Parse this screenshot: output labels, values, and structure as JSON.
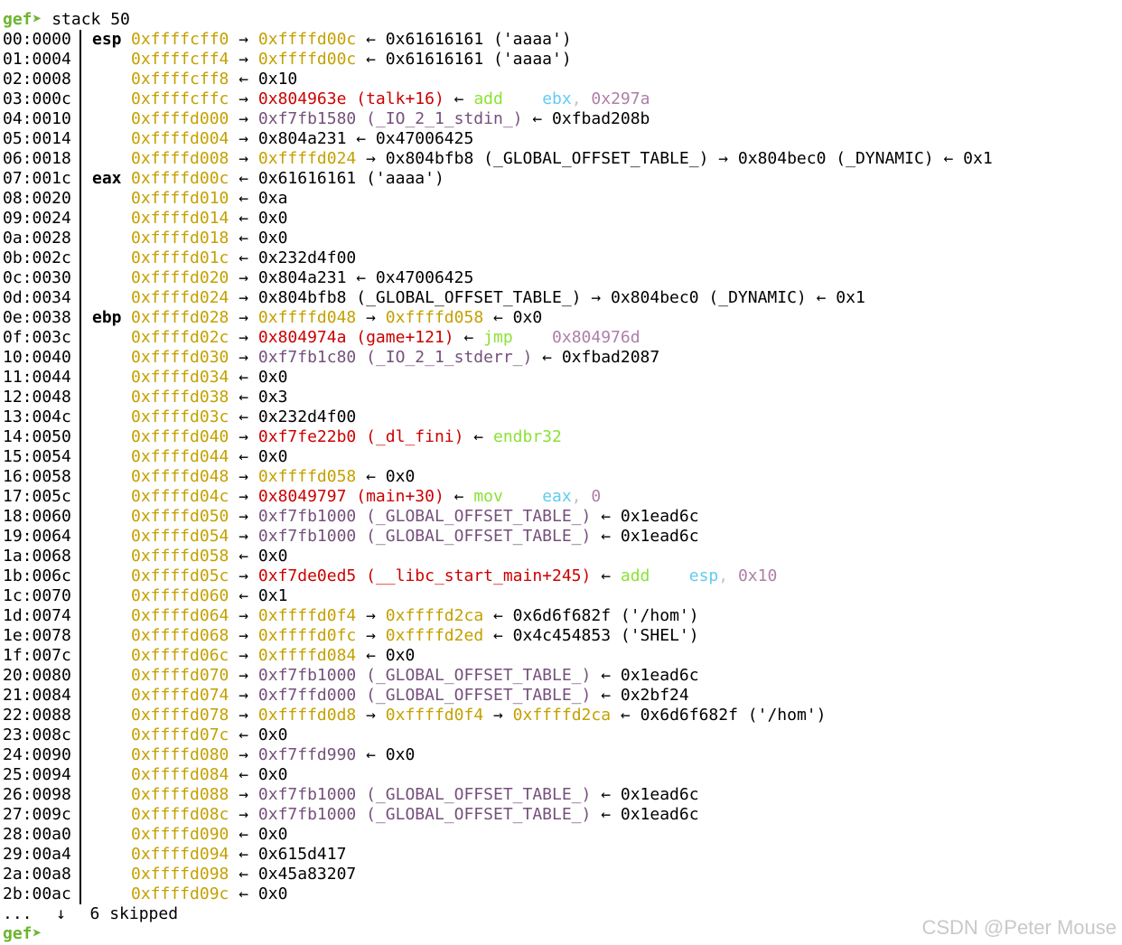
{
  "prompt": "gef➤",
  "command": "stack 50",
  "rows": [
    {
      "off": "00:0000",
      "reg": "esp",
      "spans": [
        {
          "t": "0xffffcff0",
          "c": "stack"
        },
        {
          "t": " → ",
          "c": "plain"
        },
        {
          "t": "0xffffd00c",
          "c": "stack"
        },
        {
          "t": " ← ",
          "c": "plain"
        },
        {
          "t": "0x61616161 ('aaaa')",
          "c": "plain"
        }
      ]
    },
    {
      "off": "01:0004",
      "reg": "",
      "spans": [
        {
          "t": "0xffffcff4",
          "c": "stack"
        },
        {
          "t": " → ",
          "c": "plain"
        },
        {
          "t": "0xffffd00c",
          "c": "stack"
        },
        {
          "t": " ← ",
          "c": "plain"
        },
        {
          "t": "0x61616161 ('aaaa')",
          "c": "plain"
        }
      ]
    },
    {
      "off": "02:0008",
      "reg": "",
      "spans": [
        {
          "t": "0xffffcff8",
          "c": "stack"
        },
        {
          "t": " ← ",
          "c": "plain"
        },
        {
          "t": "0x10",
          "c": "plain"
        }
      ]
    },
    {
      "off": "03:000c",
      "reg": "",
      "spans": [
        {
          "t": "0xffffcffc",
          "c": "stack"
        },
        {
          "t": " → ",
          "c": "plain"
        },
        {
          "t": "0x804963e (talk+16)",
          "c": "code"
        },
        {
          "t": " ← ",
          "c": "plain"
        },
        {
          "t": "add",
          "c": "instr"
        },
        {
          "t": "    ",
          "c": "plain"
        },
        {
          "t": "ebx",
          "c": "reg"
        },
        {
          "t": ", ",
          "c": "punct"
        },
        {
          "t": "0x297a",
          "c": "imm"
        }
      ]
    },
    {
      "off": "04:0010",
      "reg": "",
      "spans": [
        {
          "t": "0xffffd000",
          "c": "stack"
        },
        {
          "t": " → ",
          "c": "plain"
        },
        {
          "t": "0xf7fb1580 (_IO_2_1_stdin_)",
          "c": "data"
        },
        {
          "t": " ← ",
          "c": "plain"
        },
        {
          "t": "0xfbad208b",
          "c": "plain"
        }
      ]
    },
    {
      "off": "05:0014",
      "reg": "",
      "spans": [
        {
          "t": "0xffffd004",
          "c": "stack"
        },
        {
          "t": " → ",
          "c": "plain"
        },
        {
          "t": "0x804a231 ← 0x47006425",
          "c": "plain"
        }
      ]
    },
    {
      "off": "06:0018",
      "reg": "",
      "spans": [
        {
          "t": "0xffffd008",
          "c": "stack"
        },
        {
          "t": " → ",
          "c": "plain"
        },
        {
          "t": "0xffffd024",
          "c": "stack"
        },
        {
          "t": " → ",
          "c": "plain"
        },
        {
          "t": "0x804bfb8 (_GLOBAL_OFFSET_TABLE_) → 0x804bec0 (_DYNAMIC) ← 0x1",
          "c": "plain"
        }
      ]
    },
    {
      "off": "07:001c",
      "reg": "eax",
      "spans": [
        {
          "t": "0xffffd00c",
          "c": "stack"
        },
        {
          "t": " ← ",
          "c": "plain"
        },
        {
          "t": "0x61616161 ('aaaa')",
          "c": "plain"
        }
      ]
    },
    {
      "off": "08:0020",
      "reg": "",
      "spans": [
        {
          "t": "0xffffd010",
          "c": "stack"
        },
        {
          "t": " ← ",
          "c": "plain"
        },
        {
          "t": "0xa",
          "c": "plain"
        }
      ]
    },
    {
      "off": "09:0024",
      "reg": "",
      "spans": [
        {
          "t": "0xffffd014",
          "c": "stack"
        },
        {
          "t": " ← ",
          "c": "plain"
        },
        {
          "t": "0x0",
          "c": "plain"
        }
      ]
    },
    {
      "off": "0a:0028",
      "reg": "",
      "spans": [
        {
          "t": "0xffffd018",
          "c": "stack"
        },
        {
          "t": " ← ",
          "c": "plain"
        },
        {
          "t": "0x0",
          "c": "plain"
        }
      ]
    },
    {
      "off": "0b:002c",
      "reg": "",
      "spans": [
        {
          "t": "0xffffd01c",
          "c": "stack"
        },
        {
          "t": " ← ",
          "c": "plain"
        },
        {
          "t": "0x232d4f00",
          "c": "plain"
        }
      ]
    },
    {
      "off": "0c:0030",
      "reg": "",
      "spans": [
        {
          "t": "0xffffd020",
          "c": "stack"
        },
        {
          "t": " → ",
          "c": "plain"
        },
        {
          "t": "0x804a231 ← 0x47006425",
          "c": "plain"
        }
      ]
    },
    {
      "off": "0d:0034",
      "reg": "",
      "spans": [
        {
          "t": "0xffffd024",
          "c": "stack"
        },
        {
          "t": " → ",
          "c": "plain"
        },
        {
          "t": "0x804bfb8 (_GLOBAL_OFFSET_TABLE_) → 0x804bec0 (_DYNAMIC) ← 0x1",
          "c": "plain"
        }
      ]
    },
    {
      "off": "0e:0038",
      "reg": "ebp",
      "spans": [
        {
          "t": "0xffffd028",
          "c": "stack"
        },
        {
          "t": " → ",
          "c": "plain"
        },
        {
          "t": "0xffffd048",
          "c": "stack"
        },
        {
          "t": " → ",
          "c": "plain"
        },
        {
          "t": "0xffffd058",
          "c": "stack"
        },
        {
          "t": " ← ",
          "c": "plain"
        },
        {
          "t": "0x0",
          "c": "plain"
        }
      ]
    },
    {
      "off": "0f:003c",
      "reg": "",
      "spans": [
        {
          "t": "0xffffd02c",
          "c": "stack"
        },
        {
          "t": " → ",
          "c": "plain"
        },
        {
          "t": "0x804974a (game+121)",
          "c": "code"
        },
        {
          "t": " ← ",
          "c": "plain"
        },
        {
          "t": "jmp",
          "c": "instr"
        },
        {
          "t": "    ",
          "c": "plain"
        },
        {
          "t": "0x804976d",
          "c": "imm"
        }
      ]
    },
    {
      "off": "10:0040",
      "reg": "",
      "spans": [
        {
          "t": "0xffffd030",
          "c": "stack"
        },
        {
          "t": " → ",
          "c": "plain"
        },
        {
          "t": "0xf7fb1c80 (_IO_2_1_stderr_)",
          "c": "data"
        },
        {
          "t": " ← ",
          "c": "plain"
        },
        {
          "t": "0xfbad2087",
          "c": "plain"
        }
      ]
    },
    {
      "off": "11:0044",
      "reg": "",
      "spans": [
        {
          "t": "0xffffd034",
          "c": "stack"
        },
        {
          "t": " ← ",
          "c": "plain"
        },
        {
          "t": "0x0",
          "c": "plain"
        }
      ]
    },
    {
      "off": "12:0048",
      "reg": "",
      "spans": [
        {
          "t": "0xffffd038",
          "c": "stack"
        },
        {
          "t": " ← ",
          "c": "plain"
        },
        {
          "t": "0x3",
          "c": "plain"
        }
      ]
    },
    {
      "off": "13:004c",
      "reg": "",
      "spans": [
        {
          "t": "0xffffd03c",
          "c": "stack"
        },
        {
          "t": " ← ",
          "c": "plain"
        },
        {
          "t": "0x232d4f00",
          "c": "plain"
        }
      ]
    },
    {
      "off": "14:0050",
      "reg": "",
      "spans": [
        {
          "t": "0xffffd040",
          "c": "stack"
        },
        {
          "t": " → ",
          "c": "plain"
        },
        {
          "t": "0xf7fe22b0 (_dl_fini)",
          "c": "code"
        },
        {
          "t": " ← ",
          "c": "plain"
        },
        {
          "t": "endbr32",
          "c": "instr"
        }
      ]
    },
    {
      "off": "15:0054",
      "reg": "",
      "spans": [
        {
          "t": "0xffffd044",
          "c": "stack"
        },
        {
          "t": " ← ",
          "c": "plain"
        },
        {
          "t": "0x0",
          "c": "plain"
        }
      ]
    },
    {
      "off": "16:0058",
      "reg": "",
      "spans": [
        {
          "t": "0xffffd048",
          "c": "stack"
        },
        {
          "t": " → ",
          "c": "plain"
        },
        {
          "t": "0xffffd058",
          "c": "stack"
        },
        {
          "t": " ← ",
          "c": "plain"
        },
        {
          "t": "0x0",
          "c": "plain"
        }
      ]
    },
    {
      "off": "17:005c",
      "reg": "",
      "spans": [
        {
          "t": "0xffffd04c",
          "c": "stack"
        },
        {
          "t": " → ",
          "c": "plain"
        },
        {
          "t": "0x8049797 (main+30)",
          "c": "code"
        },
        {
          "t": " ← ",
          "c": "plain"
        },
        {
          "t": "mov",
          "c": "instr"
        },
        {
          "t": "    ",
          "c": "plain"
        },
        {
          "t": "eax",
          "c": "reg"
        },
        {
          "t": ", ",
          "c": "punct"
        },
        {
          "t": "0",
          "c": "imm"
        }
      ]
    },
    {
      "off": "18:0060",
      "reg": "",
      "spans": [
        {
          "t": "0xffffd050",
          "c": "stack"
        },
        {
          "t": " → ",
          "c": "plain"
        },
        {
          "t": "0xf7fb1000 (_GLOBAL_OFFSET_TABLE_)",
          "c": "data"
        },
        {
          "t": " ← ",
          "c": "plain"
        },
        {
          "t": "0x1ead6c",
          "c": "plain"
        }
      ]
    },
    {
      "off": "19:0064",
      "reg": "",
      "spans": [
        {
          "t": "0xffffd054",
          "c": "stack"
        },
        {
          "t": " → ",
          "c": "plain"
        },
        {
          "t": "0xf7fb1000 (_GLOBAL_OFFSET_TABLE_)",
          "c": "data"
        },
        {
          "t": " ← ",
          "c": "plain"
        },
        {
          "t": "0x1ead6c",
          "c": "plain"
        }
      ]
    },
    {
      "off": "1a:0068",
      "reg": "",
      "spans": [
        {
          "t": "0xffffd058",
          "c": "stack"
        },
        {
          "t": " ← ",
          "c": "plain"
        },
        {
          "t": "0x0",
          "c": "plain"
        }
      ]
    },
    {
      "off": "1b:006c",
      "reg": "",
      "spans": [
        {
          "t": "0xffffd05c",
          "c": "stack"
        },
        {
          "t": " → ",
          "c": "plain"
        },
        {
          "t": "0xf7de0ed5 (__libc_start_main+245)",
          "c": "code"
        },
        {
          "t": " ← ",
          "c": "plain"
        },
        {
          "t": "add",
          "c": "instr"
        },
        {
          "t": "    ",
          "c": "plain"
        },
        {
          "t": "esp",
          "c": "reg"
        },
        {
          "t": ", ",
          "c": "punct"
        },
        {
          "t": "0x10",
          "c": "imm"
        }
      ]
    },
    {
      "off": "1c:0070",
      "reg": "",
      "spans": [
        {
          "t": "0xffffd060",
          "c": "stack"
        },
        {
          "t": " ← ",
          "c": "plain"
        },
        {
          "t": "0x1",
          "c": "plain"
        }
      ]
    },
    {
      "off": "1d:0074",
      "reg": "",
      "spans": [
        {
          "t": "0xffffd064",
          "c": "stack"
        },
        {
          "t": " → ",
          "c": "plain"
        },
        {
          "t": "0xffffd0f4",
          "c": "stack"
        },
        {
          "t": " → ",
          "c": "plain"
        },
        {
          "t": "0xffffd2ca",
          "c": "stack"
        },
        {
          "t": " ← ",
          "c": "plain"
        },
        {
          "t": "0x6d6f682f ('/hom')",
          "c": "plain"
        }
      ]
    },
    {
      "off": "1e:0078",
      "reg": "",
      "spans": [
        {
          "t": "0xffffd068",
          "c": "stack"
        },
        {
          "t": " → ",
          "c": "plain"
        },
        {
          "t": "0xffffd0fc",
          "c": "stack"
        },
        {
          "t": " → ",
          "c": "plain"
        },
        {
          "t": "0xffffd2ed",
          "c": "stack"
        },
        {
          "t": " ← ",
          "c": "plain"
        },
        {
          "t": "0x4c454853 ('SHEL')",
          "c": "plain"
        }
      ]
    },
    {
      "off": "1f:007c",
      "reg": "",
      "spans": [
        {
          "t": "0xffffd06c",
          "c": "stack"
        },
        {
          "t": " → ",
          "c": "plain"
        },
        {
          "t": "0xffffd084",
          "c": "stack"
        },
        {
          "t": " ← ",
          "c": "plain"
        },
        {
          "t": "0x0",
          "c": "plain"
        }
      ]
    },
    {
      "off": "20:0080",
      "reg": "",
      "spans": [
        {
          "t": "0xffffd070",
          "c": "stack"
        },
        {
          "t": " → ",
          "c": "plain"
        },
        {
          "t": "0xf7fb1000 (_GLOBAL_OFFSET_TABLE_)",
          "c": "data"
        },
        {
          "t": " ← ",
          "c": "plain"
        },
        {
          "t": "0x1ead6c",
          "c": "plain"
        }
      ]
    },
    {
      "off": "21:0084",
      "reg": "",
      "spans": [
        {
          "t": "0xffffd074",
          "c": "stack"
        },
        {
          "t": " → ",
          "c": "plain"
        },
        {
          "t": "0xf7ffd000 (_GLOBAL_OFFSET_TABLE_)",
          "c": "data"
        },
        {
          "t": " ← ",
          "c": "plain"
        },
        {
          "t": "0x2bf24",
          "c": "plain"
        }
      ]
    },
    {
      "off": "22:0088",
      "reg": "",
      "spans": [
        {
          "t": "0xffffd078",
          "c": "stack"
        },
        {
          "t": " → ",
          "c": "plain"
        },
        {
          "t": "0xffffd0d8",
          "c": "stack"
        },
        {
          "t": " → ",
          "c": "plain"
        },
        {
          "t": "0xffffd0f4",
          "c": "stack"
        },
        {
          "t": " → ",
          "c": "plain"
        },
        {
          "t": "0xffffd2ca",
          "c": "stack"
        },
        {
          "t": " ← ",
          "c": "plain"
        },
        {
          "t": "0x6d6f682f ('/hom')",
          "c": "plain"
        }
      ]
    },
    {
      "off": "23:008c",
      "reg": "",
      "spans": [
        {
          "t": "0xffffd07c",
          "c": "stack"
        },
        {
          "t": " ← ",
          "c": "plain"
        },
        {
          "t": "0x0",
          "c": "plain"
        }
      ]
    },
    {
      "off": "24:0090",
      "reg": "",
      "spans": [
        {
          "t": "0xffffd080",
          "c": "stack"
        },
        {
          "t": " → ",
          "c": "plain"
        },
        {
          "t": "0xf7ffd990",
          "c": "data"
        },
        {
          "t": " ← ",
          "c": "plain"
        },
        {
          "t": "0x0",
          "c": "plain"
        }
      ]
    },
    {
      "off": "25:0094",
      "reg": "",
      "spans": [
        {
          "t": "0xffffd084",
          "c": "stack"
        },
        {
          "t": " ← ",
          "c": "plain"
        },
        {
          "t": "0x0",
          "c": "plain"
        }
      ]
    },
    {
      "off": "26:0098",
      "reg": "",
      "spans": [
        {
          "t": "0xffffd088",
          "c": "stack"
        },
        {
          "t": " → ",
          "c": "plain"
        },
        {
          "t": "0xf7fb1000 (_GLOBAL_OFFSET_TABLE_)",
          "c": "data"
        },
        {
          "t": " ← ",
          "c": "plain"
        },
        {
          "t": "0x1ead6c",
          "c": "plain"
        }
      ]
    },
    {
      "off": "27:009c",
      "reg": "",
      "spans": [
        {
          "t": "0xffffd08c",
          "c": "stack"
        },
        {
          "t": " → ",
          "c": "plain"
        },
        {
          "t": "0xf7fb1000 (_GLOBAL_OFFSET_TABLE_)",
          "c": "data"
        },
        {
          "t": " ← ",
          "c": "plain"
        },
        {
          "t": "0x1ead6c",
          "c": "plain"
        }
      ]
    },
    {
      "off": "28:00a0",
      "reg": "",
      "spans": [
        {
          "t": "0xffffd090",
          "c": "stack"
        },
        {
          "t": " ← ",
          "c": "plain"
        },
        {
          "t": "0x0",
          "c": "plain"
        }
      ]
    },
    {
      "off": "29:00a4",
      "reg": "",
      "spans": [
        {
          "t": "0xffffd094",
          "c": "stack"
        },
        {
          "t": " ← ",
          "c": "plain"
        },
        {
          "t": "0x615d417",
          "c": "plain"
        }
      ]
    },
    {
      "off": "2a:00a8",
      "reg": "",
      "spans": [
        {
          "t": "0xffffd098",
          "c": "stack"
        },
        {
          "t": " ← ",
          "c": "plain"
        },
        {
          "t": "0x45a83207",
          "c": "plain"
        }
      ]
    },
    {
      "off": "2b:00ac",
      "reg": "",
      "spans": [
        {
          "t": "0xffffd09c",
          "c": "stack"
        },
        {
          "t": " ← ",
          "c": "plain"
        },
        {
          "t": "0x0",
          "c": "plain"
        }
      ]
    }
  ],
  "skip": {
    "dots": "...",
    "arrow": "↓",
    "text": "6 skipped"
  },
  "final_prompt": "gef➤",
  "watermark": "CSDN @Peter Mouse",
  "colors": {
    "prompt": "#6cb52e",
    "stack_address": "#c4a000",
    "code_address": "#cc0000",
    "data_address": "#75507b",
    "instruction": "#8ae234",
    "register": "#63cbf0",
    "immediate": "#ad7fa8",
    "watermark": "#c9c9c9"
  }
}
